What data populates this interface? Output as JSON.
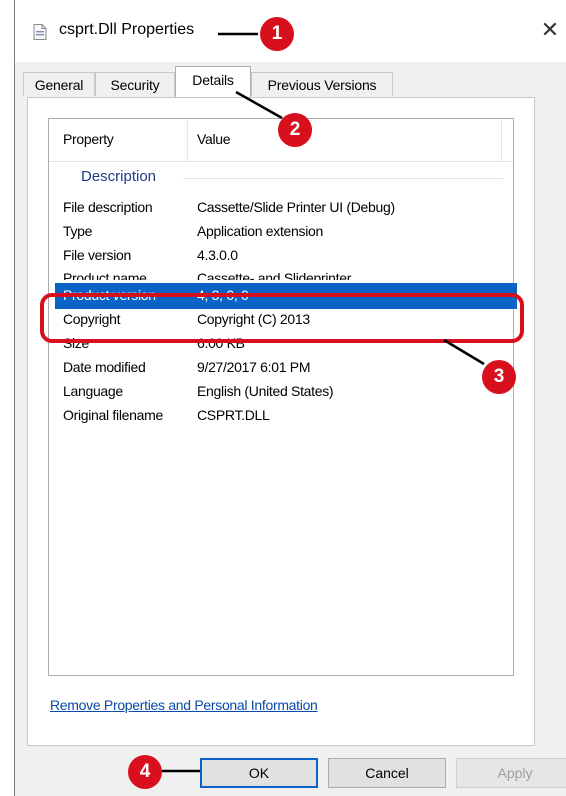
{
  "window": {
    "title": "csprt.Dll Properties",
    "close_glyph": "✕",
    "icons": {
      "file": "dll-file-icon",
      "close": "close-icon"
    }
  },
  "tabs": [
    {
      "label": "General",
      "active": false
    },
    {
      "label": "Security",
      "active": false
    },
    {
      "label": "Details",
      "active": true
    },
    {
      "label": "Previous Versions",
      "active": false
    }
  ],
  "details": {
    "columns": [
      "Property",
      "Value"
    ],
    "group": "Description",
    "rows": [
      {
        "property": "File description",
        "value": "Cassette/Slide Printer UI (Debug)",
        "selected": false
      },
      {
        "property": "Type",
        "value": "Application extension",
        "selected": false
      },
      {
        "property": "File version",
        "value": "4.3.0.0",
        "selected": false
      },
      {
        "property": "Product name",
        "value": "Cassette- and Slideprinter",
        "selected": false
      },
      {
        "property": "Product version",
        "value": "4, 3, 0, 0",
        "selected": true
      },
      {
        "property": "Copyright",
        "value": "Copyright (C) 2013",
        "selected": false
      },
      {
        "property": "Size",
        "value": "6.00 KB",
        "selected": false
      },
      {
        "property": "Date modified",
        "value": "9/27/2017 6:01 PM",
        "selected": false
      },
      {
        "property": "Language",
        "value": "English (United States)",
        "selected": false
      },
      {
        "property": "Original filename",
        "value": "CSPRT.DLL",
        "selected": false
      }
    ]
  },
  "remove_link": "Remove Properties and Personal Information",
  "buttons": {
    "ok": "OK",
    "cancel": "Cancel",
    "apply": "Apply"
  },
  "annotations": {
    "marker_color": "#d8101d",
    "markers": [
      "1",
      "2",
      "3",
      "4"
    ]
  },
  "colors": {
    "selection": "#0a64c8",
    "link": "#0a4aa8",
    "group_label": "#1e3a8a"
  }
}
